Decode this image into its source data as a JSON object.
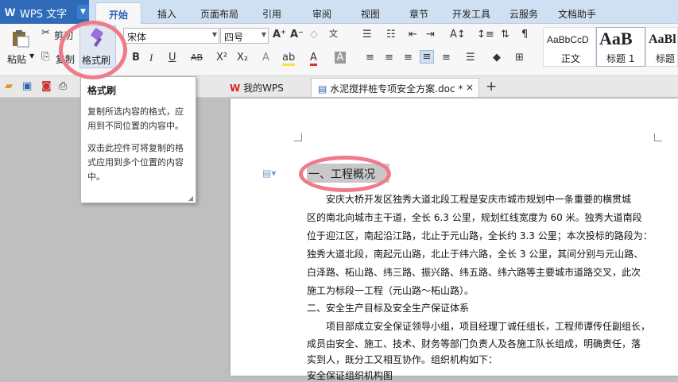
{
  "app": {
    "logo": "W",
    "name": "WPS 文字"
  },
  "menu_tabs": [
    "开始",
    "插入",
    "页面布局",
    "引用",
    "审阅",
    "视图",
    "章节",
    "开发工具",
    "云服务",
    "文档助手"
  ],
  "ribbon": {
    "paste": "粘贴",
    "cut": "剪切",
    "copy": "复制",
    "format_painter": "格式刷",
    "font_name": "宋体",
    "font_size": "四号",
    "styles": [
      {
        "preview": "AaBbCcD",
        "label": "正文"
      },
      {
        "preview": "AaB",
        "label": "标题 1"
      },
      {
        "preview": "AaBl",
        "label": "标题"
      }
    ]
  },
  "doc_tabs": [
    {
      "label": "我的WPS"
    },
    {
      "label": "水泥搅拌桩专项安全方案.doc *"
    }
  ],
  "tooltip": {
    "title": "格式刷",
    "p1": "复制所选内容的格式，应用到不同位置的内容中。",
    "p2": "双击此控件可将复制的格式应用到多个位置的内容中。"
  },
  "document": {
    "heading": "一、工程概况",
    "lines": [
      "安庆大桥开发区独秀大道北段工程是安庆市城市规划中一条重要的横贯城",
      "区的南北向城市主干道，全长 6.3 公里，规划红线宽度为 60 米。独秀大道南段",
      "位于迎江区，南起沿江路，北止于元山路，全长约 3.3 公里；本次投标的路段为：",
      "独秀大道北段，南起元山路，北止于纬六路，全长 3 公里，其间分别与元山路、",
      "白泽路、柘山路、纬三路、振兴路、纬五路、纬六路等主要城市道路交叉，此次",
      "施工为标段一工程（元山路～柘山路）。",
      "二、安全生产目标及安全生产保证体系",
      "项目部成立安全保证领导小组，项目经理丁诚任组长，工程师谭传任副组长，",
      "成员由安全、施工、技术、财务等部门负责人及各施工队长组成，明确责任，落",
      "实到人，既分工又相互协作。组织机构如下：",
      "安全保证组织机构图"
    ]
  }
}
